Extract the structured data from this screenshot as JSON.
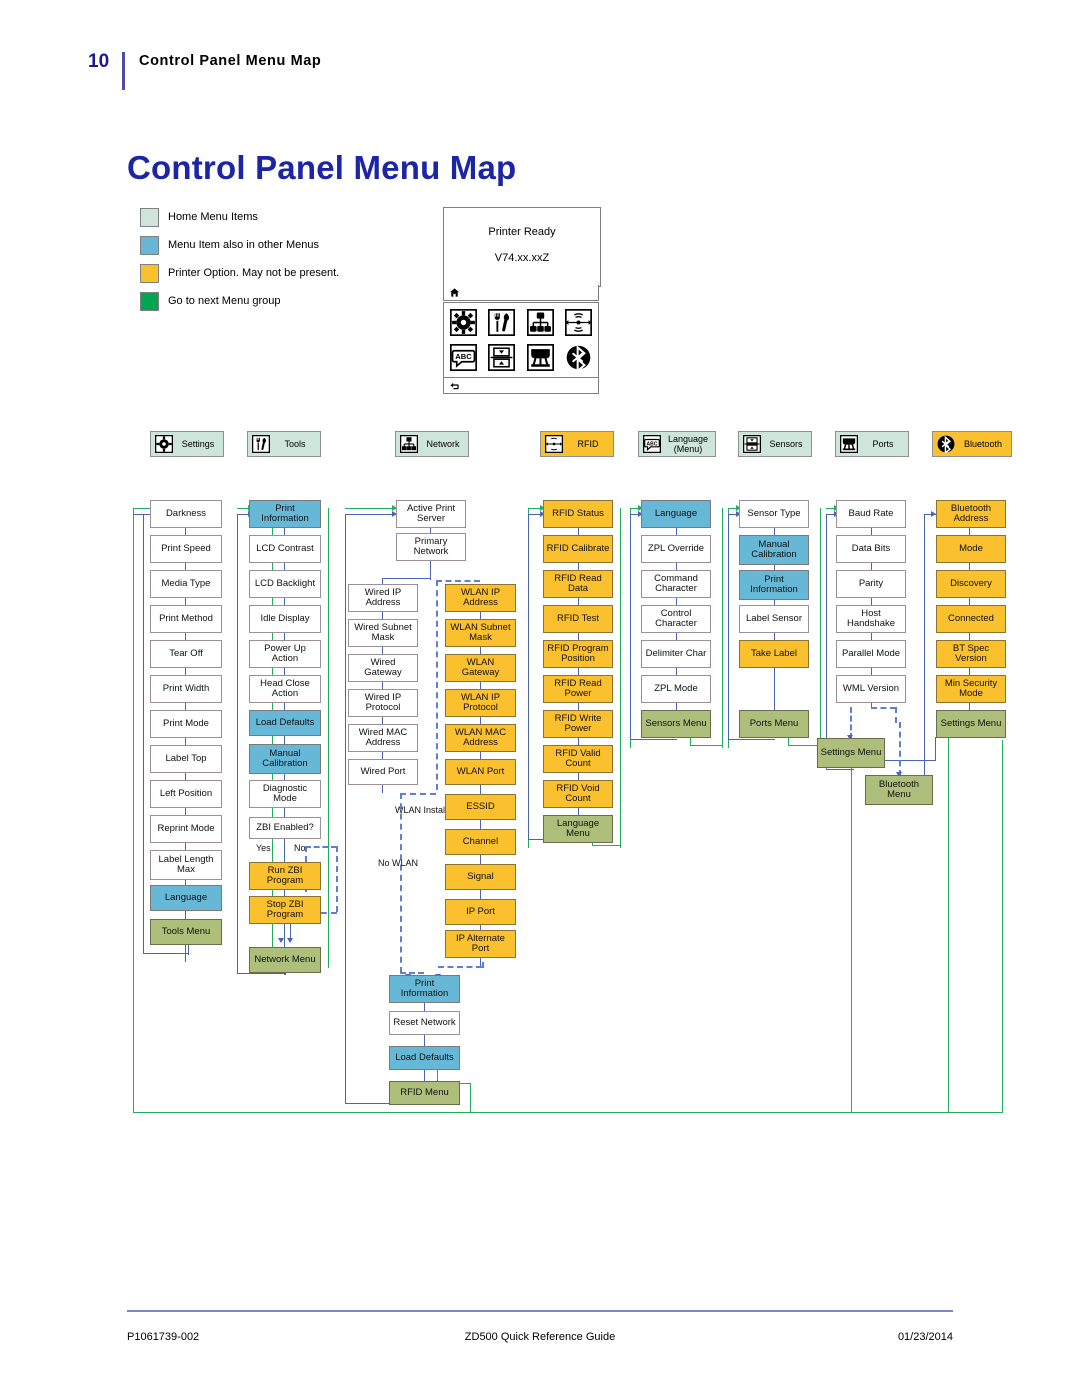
{
  "header": {
    "page_number": "10",
    "running_title": "Control Panel Menu Map"
  },
  "page_title": "Control Panel Menu Map",
  "legend": {
    "items": [
      {
        "label": "Home Menu Items",
        "color": "#cde5da"
      },
      {
        "label": "Menu Item also in other Menus",
        "color": "#66b8d6"
      },
      {
        "label": "Printer Option. May not be present.",
        "color": "#fbc02d"
      },
      {
        "label": "Go to next Menu group",
        "color": "#00a651"
      }
    ]
  },
  "lcd": {
    "line1": "Printer Ready",
    "line2": "V74.xx.xxZ",
    "home_icon": "home-icon",
    "back_icon": "back-arrow-icon",
    "icons": [
      "settings-gear-icon",
      "tools-icon",
      "network-icon",
      "rfid-icon",
      "language-abc-icon",
      "sensors-icon",
      "ports-icon",
      "bluetooth-icon"
    ]
  },
  "menu_chips": [
    {
      "label": "Settings",
      "icon": "settings-gear-icon",
      "type": "home"
    },
    {
      "label": "Tools",
      "icon": "tools-icon",
      "type": "home"
    },
    {
      "label": "Network",
      "icon": "network-icon",
      "type": "home"
    },
    {
      "label": "RFID",
      "icon": "rfid-icon",
      "type": "option"
    },
    {
      "label": "Language\n(Menu)",
      "icon": "language-abc-icon",
      "type": "home"
    },
    {
      "label": "Sensors",
      "icon": "sensors-icon",
      "type": "home"
    },
    {
      "label": "Ports",
      "icon": "ports-icon",
      "type": "home"
    },
    {
      "label": "Bluetooth",
      "icon": "bluetooth-icon",
      "type": "option"
    }
  ],
  "columns": {
    "settings": [
      {
        "label": "Darkness",
        "style": "white"
      },
      {
        "label": "Print Speed",
        "style": "white"
      },
      {
        "label": "Media Type",
        "style": "white"
      },
      {
        "label": "Print Method",
        "style": "white"
      },
      {
        "label": "Tear Off",
        "style": "white"
      },
      {
        "label": "Print Width",
        "style": "white"
      },
      {
        "label": "Print Mode",
        "style": "white"
      },
      {
        "label": "Label Top",
        "style": "white"
      },
      {
        "label": "Left Position",
        "style": "white"
      },
      {
        "label": "Reprint Mode",
        "style": "white"
      },
      {
        "label": "Label Length Max",
        "style": "white"
      },
      {
        "label": "Language",
        "style": "blue"
      },
      {
        "label": "Tools Menu",
        "style": "green"
      }
    ],
    "tools": [
      {
        "label": "Print Information",
        "style": "blue"
      },
      {
        "label": "LCD Contrast",
        "style": "white"
      },
      {
        "label": "LCD Backlight",
        "style": "white"
      },
      {
        "label": "Idle Display",
        "style": "white"
      },
      {
        "label": "Power Up Action",
        "style": "white"
      },
      {
        "label": "Head Close Action",
        "style": "white"
      },
      {
        "label": "Load Defaults",
        "style": "blue"
      },
      {
        "label": "Manual Calibration",
        "style": "blue"
      },
      {
        "label": "Diagnostic Mode",
        "style": "white"
      },
      {
        "label": "ZBI Enabled?",
        "style": "white"
      },
      {
        "label": "Run ZBI Program",
        "style": "amber"
      },
      {
        "label": "Stop ZBI Program",
        "style": "amber"
      },
      {
        "label": "Network Menu",
        "style": "green"
      }
    ],
    "tools_branch_labels": {
      "yes": "Yes",
      "no": "No"
    },
    "network_top": [
      {
        "label": "Active Print Server",
        "style": "white"
      },
      {
        "label": "Primary Network",
        "style": "white"
      }
    ],
    "network_wired": [
      {
        "label": "Wired IP Address",
        "style": "white"
      },
      {
        "label": "Wired Subnet Mask",
        "style": "white"
      },
      {
        "label": "Wired Gateway",
        "style": "white"
      },
      {
        "label": "Wired IP Protocol",
        "style": "white"
      },
      {
        "label": "Wired MAC Address",
        "style": "white"
      },
      {
        "label": "Wired Port",
        "style": "white"
      }
    ],
    "network_wlan": [
      {
        "label": "WLAN IP Address",
        "style": "amber"
      },
      {
        "label": "WLAN Subnet Mask",
        "style": "amber"
      },
      {
        "label": "WLAN Gateway",
        "style": "amber"
      },
      {
        "label": "WLAN IP Protocol",
        "style": "amber"
      },
      {
        "label": "WLAN MAC Address",
        "style": "amber"
      },
      {
        "label": "WLAN Port",
        "style": "amber"
      },
      {
        "label": "ESSID",
        "style": "amber"
      },
      {
        "label": "Channel",
        "style": "amber"
      },
      {
        "label": "Signal",
        "style": "amber"
      },
      {
        "label": "IP Port",
        "style": "amber"
      },
      {
        "label": "IP Alternate Port",
        "style": "amber"
      }
    ],
    "network_branch_labels": {
      "wlan": "WLAN Installed",
      "nowlan": "No WLAN"
    },
    "network_bottom": [
      {
        "label": "Print Information",
        "style": "blue"
      },
      {
        "label": "Reset Network",
        "style": "white"
      },
      {
        "label": "Load Defaults",
        "style": "blue"
      },
      {
        "label": "RFID Menu",
        "style": "green"
      }
    ],
    "rfid": [
      {
        "label": "RFID Status",
        "style": "amber"
      },
      {
        "label": "RFID Calibrate",
        "style": "amber"
      },
      {
        "label": "RFID Read Data",
        "style": "amber"
      },
      {
        "label": "RFID Test",
        "style": "amber"
      },
      {
        "label": "RFID Program Position",
        "style": "amber"
      },
      {
        "label": "RFID Read Power",
        "style": "amber"
      },
      {
        "label": "RFID Write Power",
        "style": "amber"
      },
      {
        "label": "RFID Valid Count",
        "style": "amber"
      },
      {
        "label": "RFID Void Count",
        "style": "amber"
      },
      {
        "label": "Language Menu",
        "style": "green"
      }
    ],
    "language": [
      {
        "label": "Language",
        "style": "blue"
      },
      {
        "label": "ZPL Override",
        "style": "white"
      },
      {
        "label": "Command Character",
        "style": "white"
      },
      {
        "label": "Control Character",
        "style": "white"
      },
      {
        "label": "Delimiter Char",
        "style": "white"
      },
      {
        "label": "ZPL Mode",
        "style": "white"
      },
      {
        "label": "Sensors Menu",
        "style": "green"
      }
    ],
    "sensors": [
      {
        "label": "Sensor Type",
        "style": "white"
      },
      {
        "label": "Manual Calibration",
        "style": "blue"
      },
      {
        "label": "Print Information",
        "style": "blue"
      },
      {
        "label": "Label Sensor",
        "style": "white"
      },
      {
        "label": "Take Label",
        "style": "amber"
      },
      {
        "label": "Ports Menu",
        "style": "green"
      }
    ],
    "ports": [
      {
        "label": "Baud Rate",
        "style": "white"
      },
      {
        "label": "Data Bits",
        "style": "white"
      },
      {
        "label": "Parity",
        "style": "white"
      },
      {
        "label": "Host Handshake",
        "style": "white"
      },
      {
        "label": "Parallel Mode",
        "style": "white"
      },
      {
        "label": "WML Version",
        "style": "white"
      }
    ],
    "ports_exits": [
      {
        "label": "Settings Menu",
        "style": "green"
      },
      {
        "label": "Bluetooth Menu",
        "style": "green"
      }
    ],
    "bluetooth": [
      {
        "label": "Bluetooth Address",
        "style": "amber"
      },
      {
        "label": "Mode",
        "style": "amber"
      },
      {
        "label": "Discovery",
        "style": "amber"
      },
      {
        "label": "Connected",
        "style": "amber"
      },
      {
        "label": "BT Spec Version",
        "style": "amber"
      },
      {
        "label": "Min Security Mode",
        "style": "amber"
      },
      {
        "label": "Settings Menu",
        "style": "green"
      }
    ]
  },
  "footer": {
    "left": "P1061739-002",
    "center": "ZD500 Quick Reference Guide",
    "right": "01/23/2014"
  }
}
